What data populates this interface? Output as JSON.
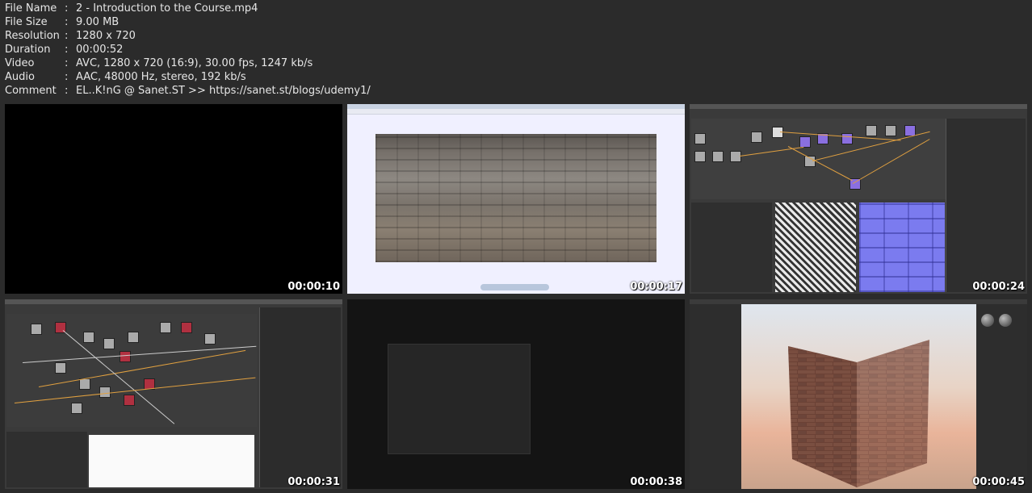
{
  "metadata": [
    {
      "key": "File Name",
      "value": "2 - Introduction to the Course.mp4"
    },
    {
      "key": "File Size",
      "value": "9.00 MB"
    },
    {
      "key": "Resolution",
      "value": "1280 x 720"
    },
    {
      "key": "Duration",
      "value": "00:00:52"
    },
    {
      "key": "Video",
      "value": "AVC, 1280 x 720 (16:9), 30.00 fps, 1247 kb/s"
    },
    {
      "key": "Audio",
      "value": "AAC, 48000 Hz, stereo, 192 kb/s"
    },
    {
      "key": "Comment",
      "value": "EL..K!nG @ Sanet.ST >> https://sanet.st/blogs/udemy1/"
    }
  ],
  "separator": ":",
  "thumbnails": [
    {
      "timestamp": "00:00:10"
    },
    {
      "timestamp": "00:00:17"
    },
    {
      "timestamp": "00:00:24"
    },
    {
      "timestamp": "00:00:31"
    },
    {
      "timestamp": "00:00:38"
    },
    {
      "timestamp": "00:00:45"
    }
  ]
}
